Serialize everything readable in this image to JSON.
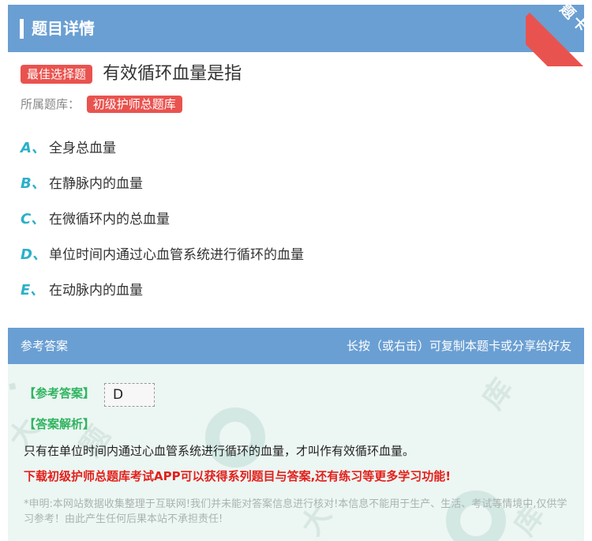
{
  "header": {
    "title": "题目详情",
    "ribbon_label": "题卡"
  },
  "question": {
    "badge": "最佳选择题",
    "text": "有效循环血量是指",
    "bank_label": "所属题库：",
    "bank_name": "初级护师总题库"
  },
  "options": [
    {
      "letter": "A、",
      "text": "全身总血量"
    },
    {
      "letter": "B、",
      "text": "在静脉内的血量"
    },
    {
      "letter": "C、",
      "text": "在微循环内的总血量"
    },
    {
      "letter": "D、",
      "text": "单位时间内通过心血管系统进行循环的血量"
    },
    {
      "letter": "E、",
      "text": "在动脉内的血量"
    }
  ],
  "answer_section": {
    "title": "参考答案",
    "hint": "长按（或右击）可复制本题卡或分享给好友",
    "answer_label": "【参考答案】",
    "answer_value": "D",
    "analysis_label": "【答案解析】",
    "analysis_text": "只有在单位时间内通过心血管系统进行循环的血量，才叫作有效循环血量。",
    "promo": "下载初级护师总题库考试APP可以获得系列题目与答案,还有练习等更多学习功能!",
    "disclaimer": "*申明:本网站数据收集整理于互联网!我们并未能对答案信息进行核对!本信息不能用于生产、生活、考试等情境中,仅供学习参考！由此产生任何后果本站不承担责任!"
  },
  "colors": {
    "header_bg": "#6a9fd3",
    "accent_red": "#e9534f",
    "option_letter": "#2bb0c9",
    "answer_green": "#2fb45f",
    "promo_red": "#e3201b"
  }
}
